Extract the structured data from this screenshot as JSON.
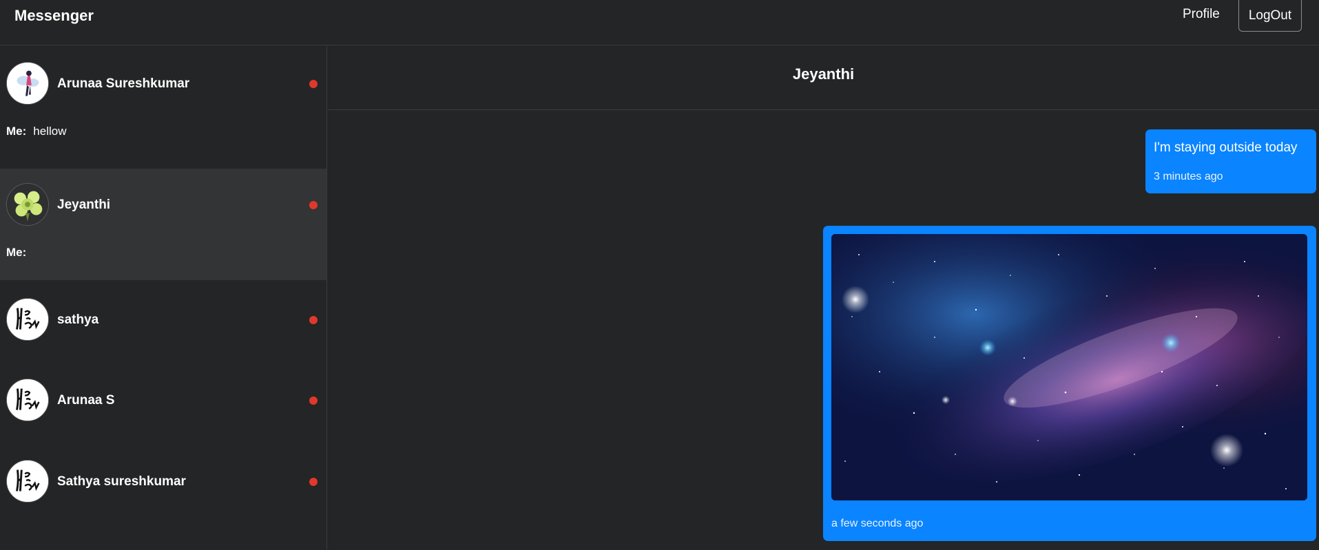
{
  "navbar": {
    "brand": "Messenger",
    "profile_label": "Profile",
    "logout_label": "LogOut"
  },
  "sidebar": {
    "contacts": [
      {
        "name": "Arunaa Sureshkumar",
        "preview_prefix": "Me:",
        "preview_text": "hellow",
        "status": "offline",
        "avatar": "illustrated-woman-avatar"
      },
      {
        "name": "Jeyanthi",
        "preview_prefix": "Me:",
        "preview_text": "",
        "status": "offline",
        "avatar": "green-flower-avatar",
        "active": true
      },
      {
        "name": "sathya",
        "status": "offline",
        "avatar": "handwritten-logo-avatar"
      },
      {
        "name": "Arunaa S",
        "status": "offline",
        "avatar": "handwritten-logo-avatar"
      },
      {
        "name": "Sathya sureshkumar",
        "status": "offline",
        "avatar": "handwritten-logo-avatar"
      }
    ]
  },
  "chat": {
    "title": "Jeyanthi",
    "messages": [
      {
        "type": "text",
        "text": "I'm staying outside today",
        "time": "3 minutes ago",
        "sender": "me"
      },
      {
        "type": "image",
        "image": "galaxy-starfield-image",
        "time": "a few seconds ago",
        "sender": "me"
      }
    ]
  },
  "colors": {
    "background": "#242526",
    "active_contact": "#333435",
    "bubble": "#0a84ff",
    "status_dot": "#e0382b"
  }
}
